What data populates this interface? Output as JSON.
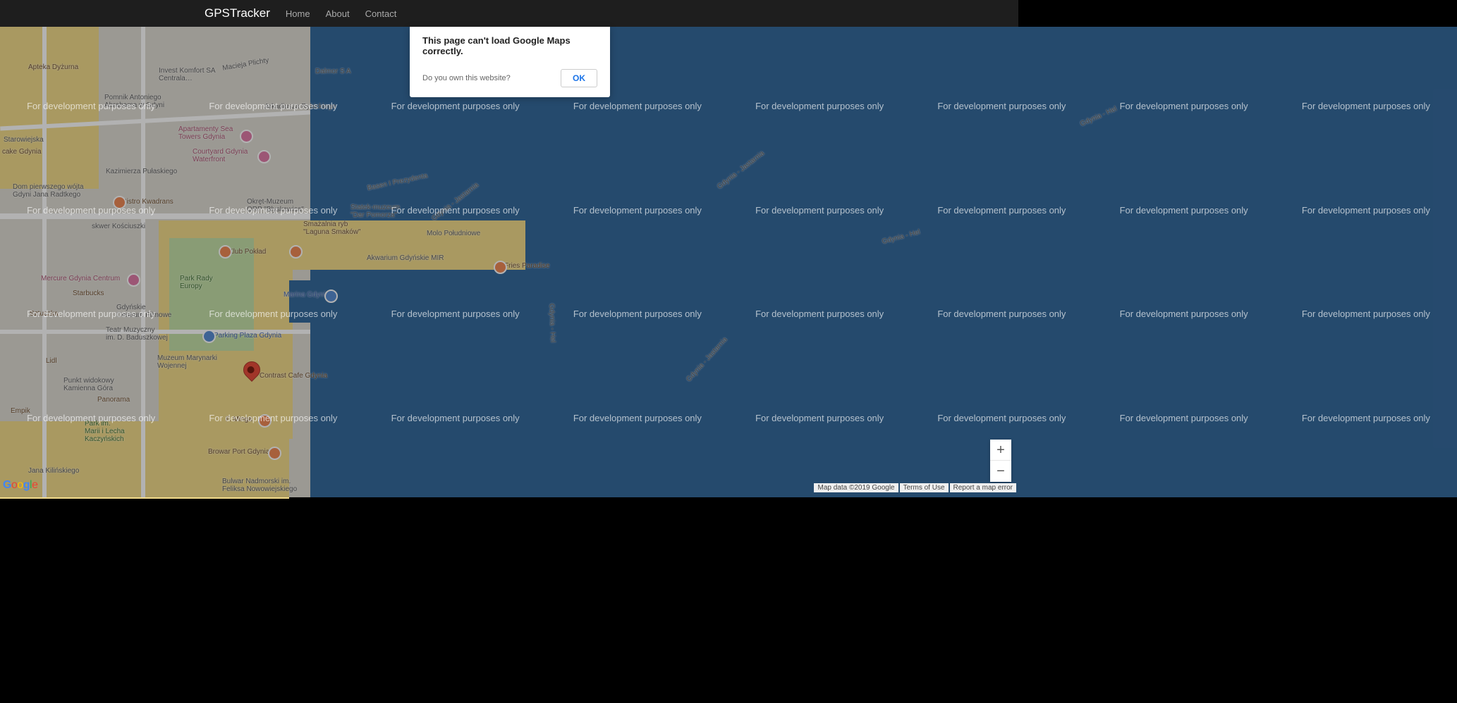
{
  "nav": {
    "brand": "GPSTracker",
    "links": [
      "Home",
      "About",
      "Contact"
    ]
  },
  "modal": {
    "title": "This page can't load Google Maps correctly.",
    "question": "Do you own this website?",
    "ok": "OK"
  },
  "watermark": "For development purposes only",
  "attribution": {
    "map_data": "Map data ©2019 Google",
    "terms": "Terms of Use",
    "report": "Report a map error"
  },
  "zoom": {
    "in": "+",
    "out": "−"
  },
  "logo": "Google",
  "poi": {
    "apteka": "Apteka Dyżurna",
    "invest": "Invest Komfort SA\nCentrala…",
    "dalmor": "Dalmor S A",
    "pomnik": "Pomnik Antoniego\nAbrahama w Gdyni",
    "sea_towers": "Apartamenty Sea\nTowers Gdynia",
    "courtyard": "Courtyard Gdynia\nWaterfront",
    "cake": "cake Gdynia",
    "starowiejska": "Starowiejska",
    "pulaskiego": "Kazimierza Pułaskiego",
    "wojt": "Dom pierwszego wójta\nGdyni Jana Radtkego",
    "bistro": "Bistro Kwadrans",
    "kosciuszki": "skwer Kościuszki",
    "okret": "Okręt-Muzeum\nORP \"Błyskawica\"",
    "statek": "Statek-muzeum\n\"Dar Pomorza\"",
    "smazalnia": "Smażalnia ryb\n\"Laguna Smaków\"",
    "poklad": "Klub Pokład",
    "akwarium": "Akwarium Gdyńskie MIR",
    "molo": "Molo Południowe",
    "fries": "Fries Paradise",
    "park_rady": "Park Rady\nEuropy",
    "mercure": "Mercure Gdynia Centrum",
    "starbucks": "Starbucks",
    "sztuczka": "Sztuczka",
    "filmowe": "Gdyńskie\nCentrum Filmowe",
    "teatr": "Teatr Muzyczny\nim. D. Baduszkowej",
    "parking": "Parking Plaza Gdynia",
    "marina": "Marina Gdynia",
    "muzeum_mw": "Muzeum Marynarki\nWojennej",
    "lidl": "Lidl",
    "widokowy": "Punkt widokowy\nKamienna Góra",
    "panorama": "Panorama",
    "empik": "Empik",
    "contrast": "Contrast Cafe Gdynia",
    "minga": "F. Minga",
    "park_marii": "Park im.\nMarii i Lecha\nKaczyńskich",
    "browar": "Browar Port Gdynia",
    "kilinskiego": "Jana Kilińskiego",
    "bulwar": "Bulwar Nadmorski im.\nFeliksa Nowowiejskiego",
    "basen": "Basen I Prezydenta",
    "ferry1": "Gdynia - Jastarnia",
    "ferry2": "Gdynia - Hel",
    "rybickiego": "Arkadiusza Rybickiego",
    "plichty": "Macieja Plichty"
  }
}
